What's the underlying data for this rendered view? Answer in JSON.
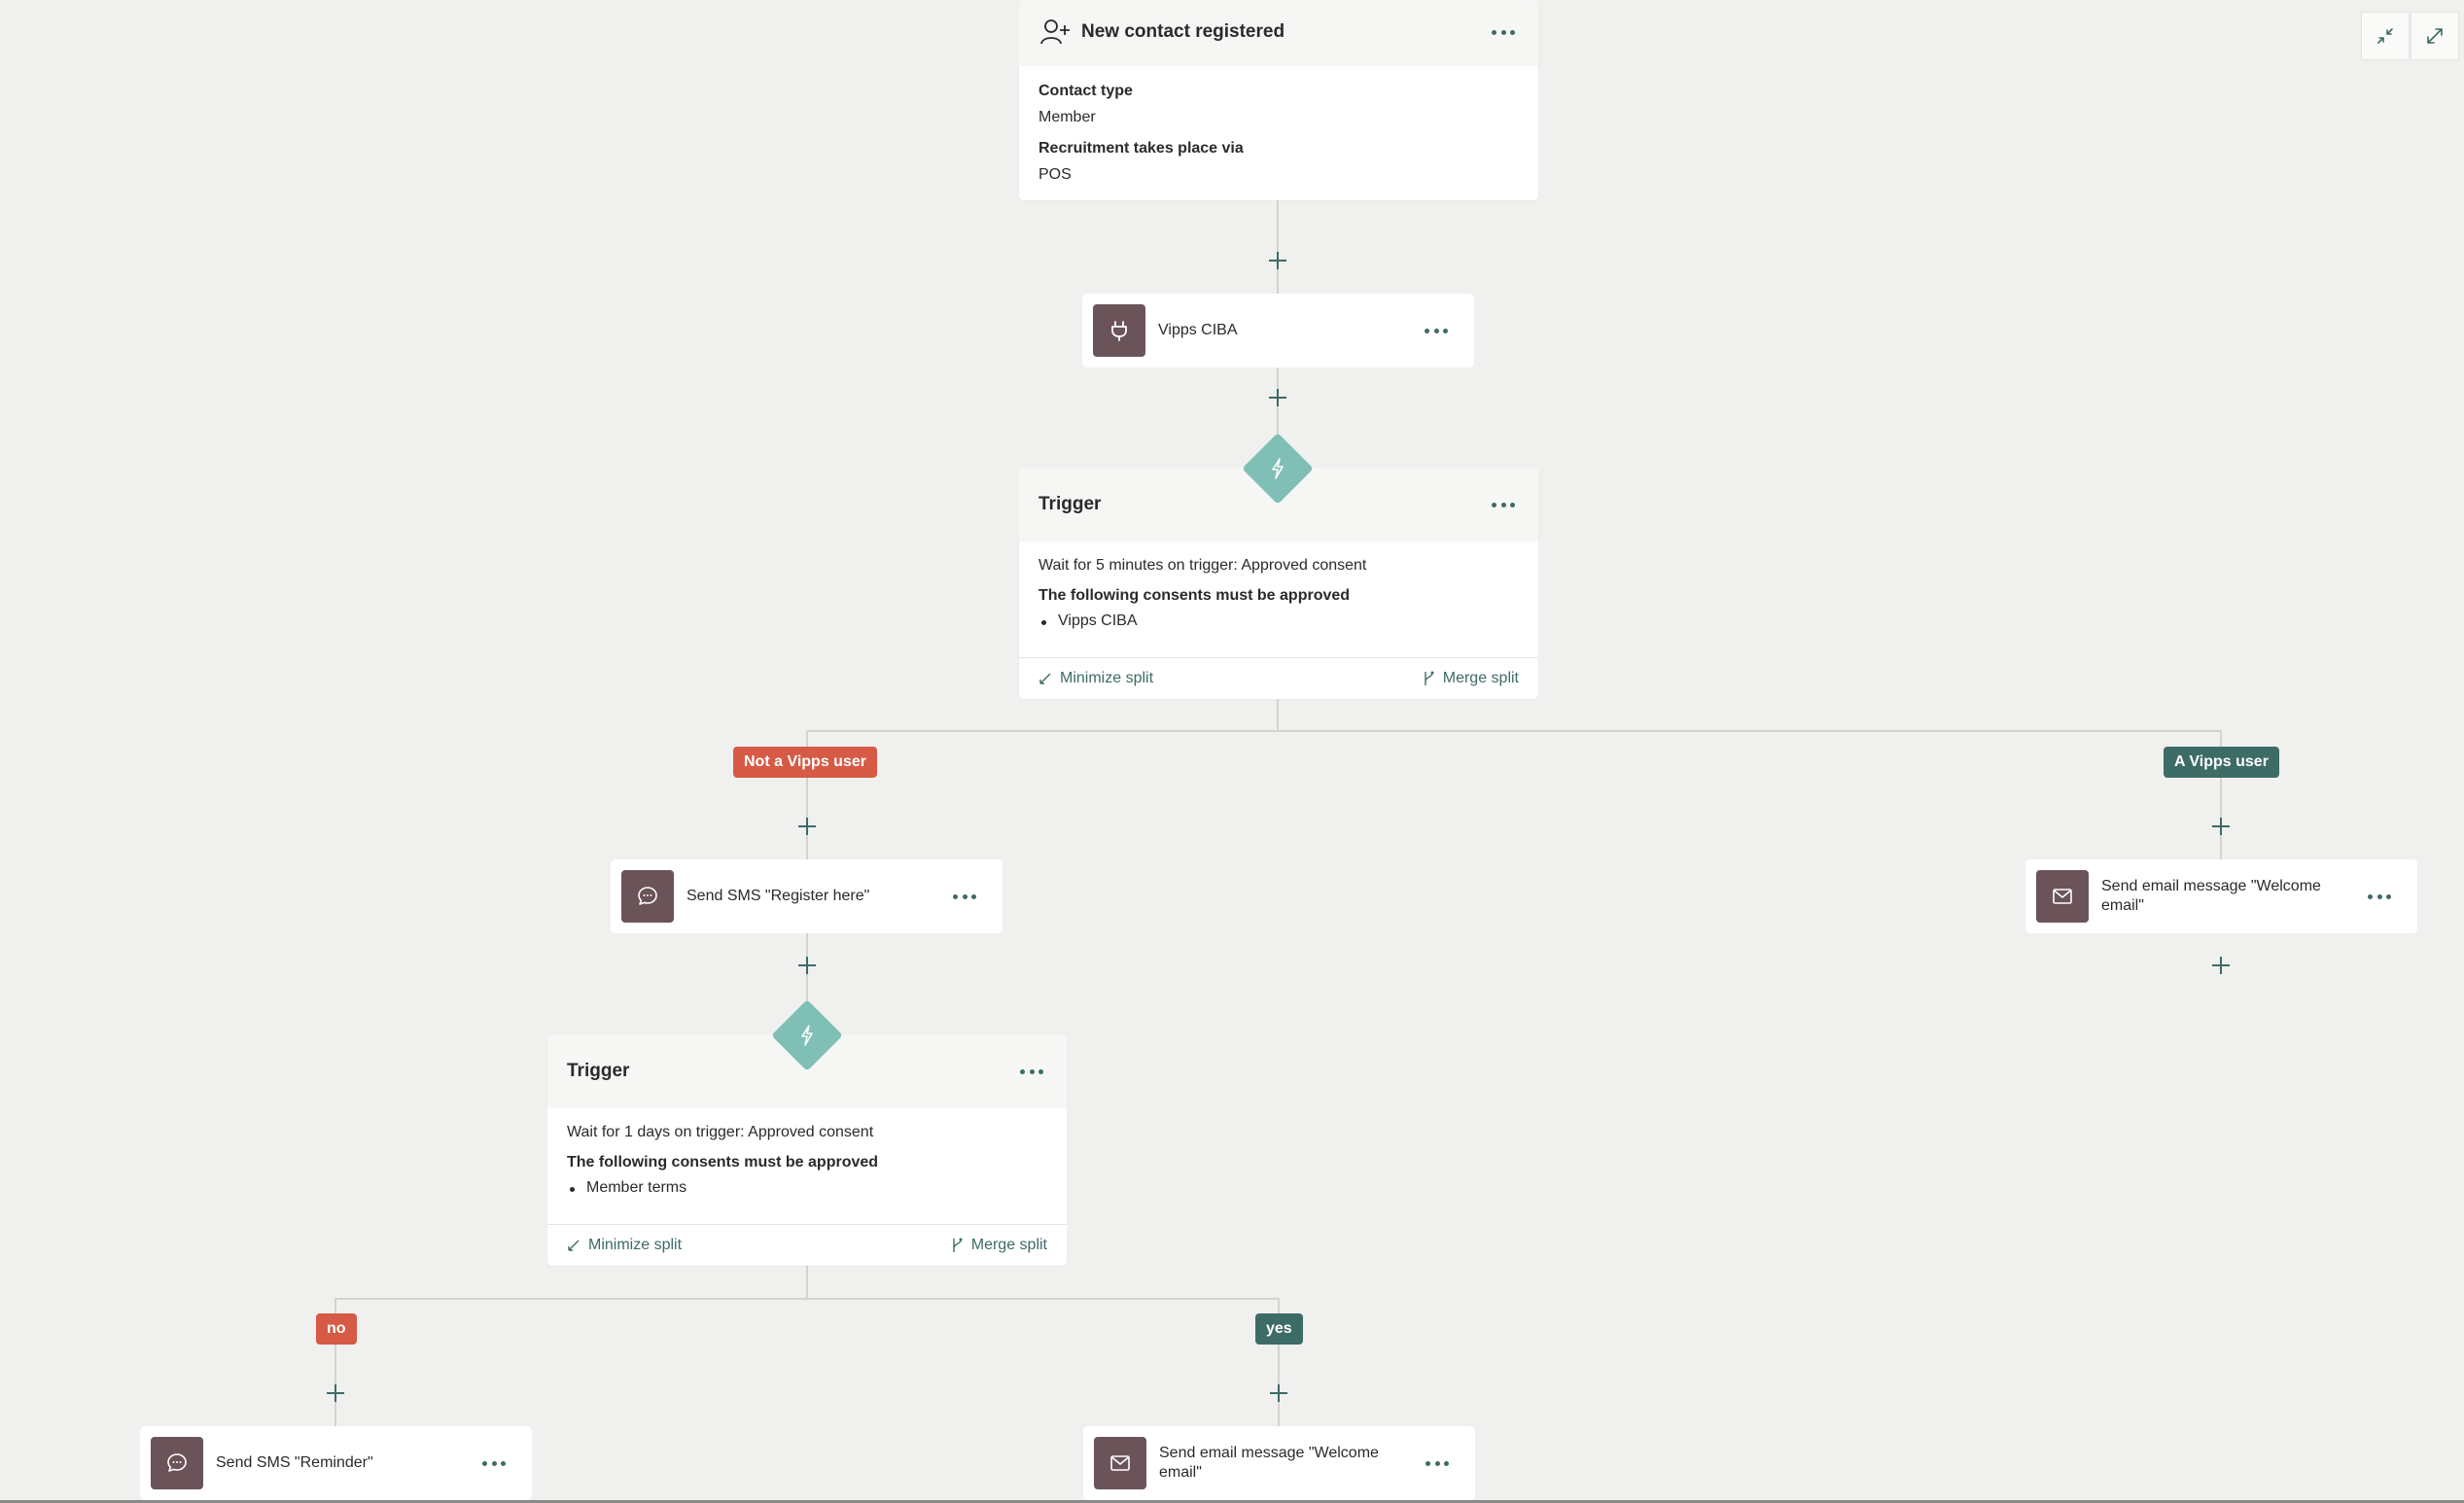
{
  "start_node": {
    "title": "New contact registered",
    "fields": [
      {
        "label": "Contact type",
        "value": "Member"
      },
      {
        "label": "Recruitment takes place via",
        "value": "POS"
      }
    ]
  },
  "vipps_node": {
    "label": "Vipps CIBA"
  },
  "trigger1": {
    "title": "Trigger",
    "wait_text": "Wait for 5 minutes on trigger: Approved consent",
    "consents_heading": "The following consents must be approved",
    "consents": [
      "Vipps CIBA"
    ],
    "minimize_label": "Minimize split",
    "merge_label": "Merge split"
  },
  "branch1": {
    "no_label": "Not a Vipps user",
    "yes_label": "A Vipps user"
  },
  "sms_register": {
    "label": "Send SMS \"Register here\""
  },
  "email_welcome_1": {
    "label": "Send email message \"Welcome email\""
  },
  "trigger2": {
    "title": "Trigger",
    "wait_text": "Wait for 1 days on trigger: Approved consent",
    "consents_heading": "The following consents must be approved",
    "consents": [
      "Member terms"
    ],
    "minimize_label": "Minimize split",
    "merge_label": "Merge split"
  },
  "branch2": {
    "no_label": "no",
    "yes_label": "yes"
  },
  "sms_reminder": {
    "label": "Send SMS \"Reminder\""
  },
  "email_welcome_2": {
    "label": "Send email message \"Welcome email\""
  },
  "colors": {
    "accent": "#3d6b66",
    "trigger_diamond": "#7fbfb5",
    "action_icon_bg": "#6b5459",
    "tag_no": "#d65a45",
    "tag_yes": "#3d6b66",
    "canvas": "#f0f0ef"
  }
}
